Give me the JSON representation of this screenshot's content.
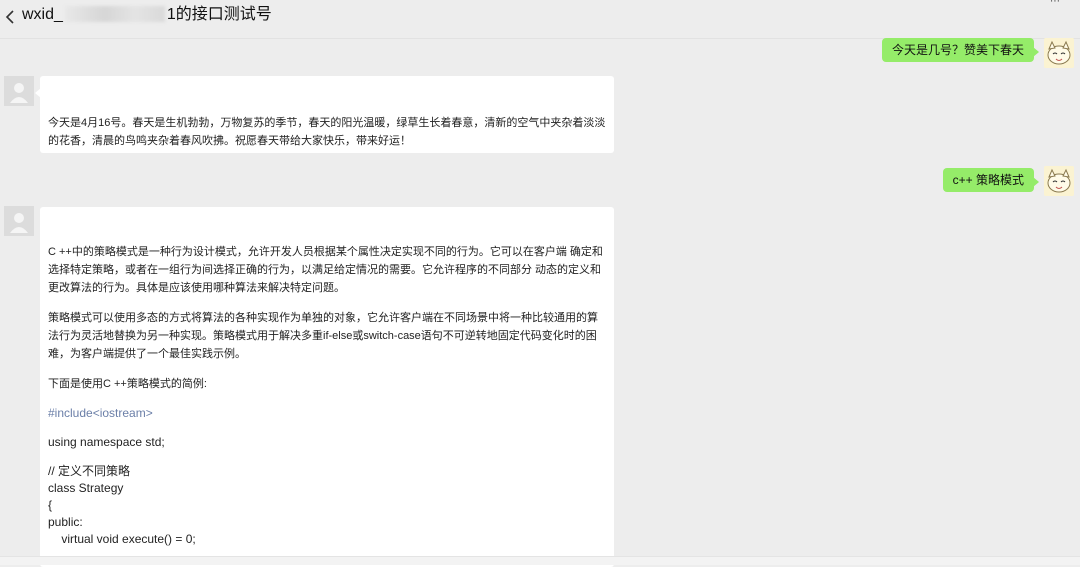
{
  "header": {
    "title_prefix": "wxid_",
    "title_suffix": "1的接口测试号"
  },
  "messages": [
    {
      "sender": "me",
      "text": "今天是几号？赞美下春天"
    },
    {
      "sender": "bot",
      "paragraphs": [
        "今天是4月16号。春天是生机勃勃，万物复苏的季节，春天的阳光温暖，绿草生长着春意，清新的空气中夹杂着淡淡的花香，清晨的鸟鸣夹杂着春风吹拂。祝愿春天带给大家快乐，带来好运！"
      ]
    },
    {
      "sender": "me",
      "text": "c++ 策略模式"
    },
    {
      "sender": "bot",
      "paragraphs": [
        "C ++中的策略模式是一种行为设计模式，允许开发人员根据某个属性决定实现不同的行为。它可以在客户端 确定和选择特定策略，或者在一组行为间选择正确的行为，以满足给定情况的需要。它允许程序的不同部分 动态的定义和更改算法的行为。具体是应该使用哪种算法来解决特定问题。",
        "策略模式可以使用多态的方式将算法的各种实现作为单独的对象，它允许客户端在不同场景中将一种比较通用的算法行为灵活地替换为另一种实现。策略模式用于解决多重if-else或switch-case语句不可逆转地固定代码变化时的困难，为客户端提供了一个最佳实践示例。",
        "下面是使用C ++策略模式的简例:"
      ],
      "code": {
        "include": "#include<iostream>",
        "namespace": "using namespace std;",
        "comment": "// 定义不同策略",
        "class_line": "class Strategy",
        "brace": "{",
        "public": "public:",
        "method": "    virtual void execute() = 0;"
      }
    }
  ],
  "colors": {
    "background": "#ededed",
    "my_bubble": "#95ec69",
    "bot_bubble": "#ffffff",
    "code_include": "#6b7fa8"
  },
  "icons": [
    "chevron-left-icon",
    "more-icon",
    "default-avatar-icon",
    "cat-avatar-icon"
  ]
}
